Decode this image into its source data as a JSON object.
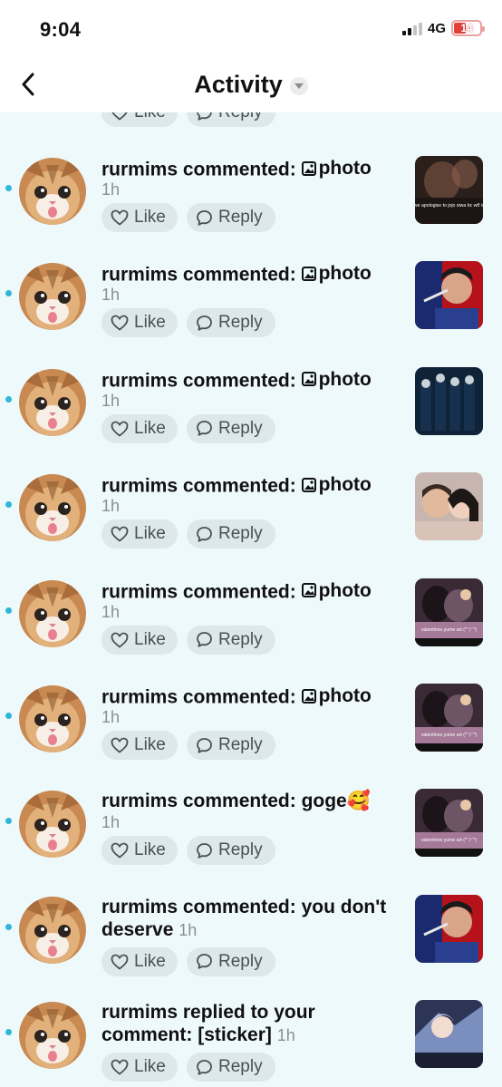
{
  "status_bar": {
    "time": "9:04",
    "network": "4G",
    "battery": "14"
  },
  "header": {
    "title": "Activity"
  },
  "partial_actions": {
    "like": "Like",
    "reply": "Reply"
  },
  "items": [
    {
      "user": "rurmims",
      "action": "commented:",
      "body": "photo",
      "has_photo_icon": true,
      "time": "1h",
      "like": "Like",
      "reply": "Reply",
      "thumb_caption": "can we apologise to jojo siwa bc wtf is this",
      "thumb": "dark-room"
    },
    {
      "user": "rurmims",
      "action": "commented:",
      "body": "photo",
      "has_photo_icon": true,
      "time": "1h",
      "like": "Like",
      "reply": "Reply",
      "thumb_caption": "",
      "thumb": "red-portrait"
    },
    {
      "user": "rurmims",
      "action": "commented:",
      "body": "photo",
      "has_photo_icon": true,
      "time": "1h",
      "like": "Like",
      "reply": "Reply",
      "thumb_caption": "",
      "thumb": "blue-group"
    },
    {
      "user": "rurmims",
      "action": "commented:",
      "body": "photo",
      "has_photo_icon": true,
      "time": "1h",
      "like": "Like",
      "reply": "Reply",
      "thumb_caption": "",
      "thumb": "couple"
    },
    {
      "user": "rurmims",
      "action": "commented:",
      "body": "photo",
      "has_photo_icon": true,
      "time": "1h",
      "like": "Like",
      "reply": "Reply",
      "thumb_caption": "valentines yume art (*´▽`*)",
      "thumb": "pink-art"
    },
    {
      "user": "rurmims",
      "action": "commented:",
      "body": "photo",
      "has_photo_icon": true,
      "time": "1h",
      "like": "Like",
      "reply": "Reply",
      "thumb_caption": "valentines yume art (*´▽`*)",
      "thumb": "pink-art"
    },
    {
      "user": "rurmims",
      "action": "commented:",
      "body": "goge🥰",
      "has_photo_icon": false,
      "time": "1h",
      "like": "Like",
      "reply": "Reply",
      "thumb_caption": "valentines yume art (*´▽`*)",
      "thumb": "pink-art"
    },
    {
      "user": "rurmims",
      "action": "commented:",
      "body": "you don't deserve",
      "has_photo_icon": false,
      "time": "1h",
      "like": "Like",
      "reply": "Reply",
      "thumb_caption": "",
      "thumb": "red-portrait"
    },
    {
      "user": "rurmims",
      "action": "replied to your comment:",
      "body": " [sticker]",
      "has_photo_icon": false,
      "time": "1h",
      "like": "Like",
      "reply": "Reply",
      "thumb_caption": "",
      "thumb": "anime"
    }
  ]
}
